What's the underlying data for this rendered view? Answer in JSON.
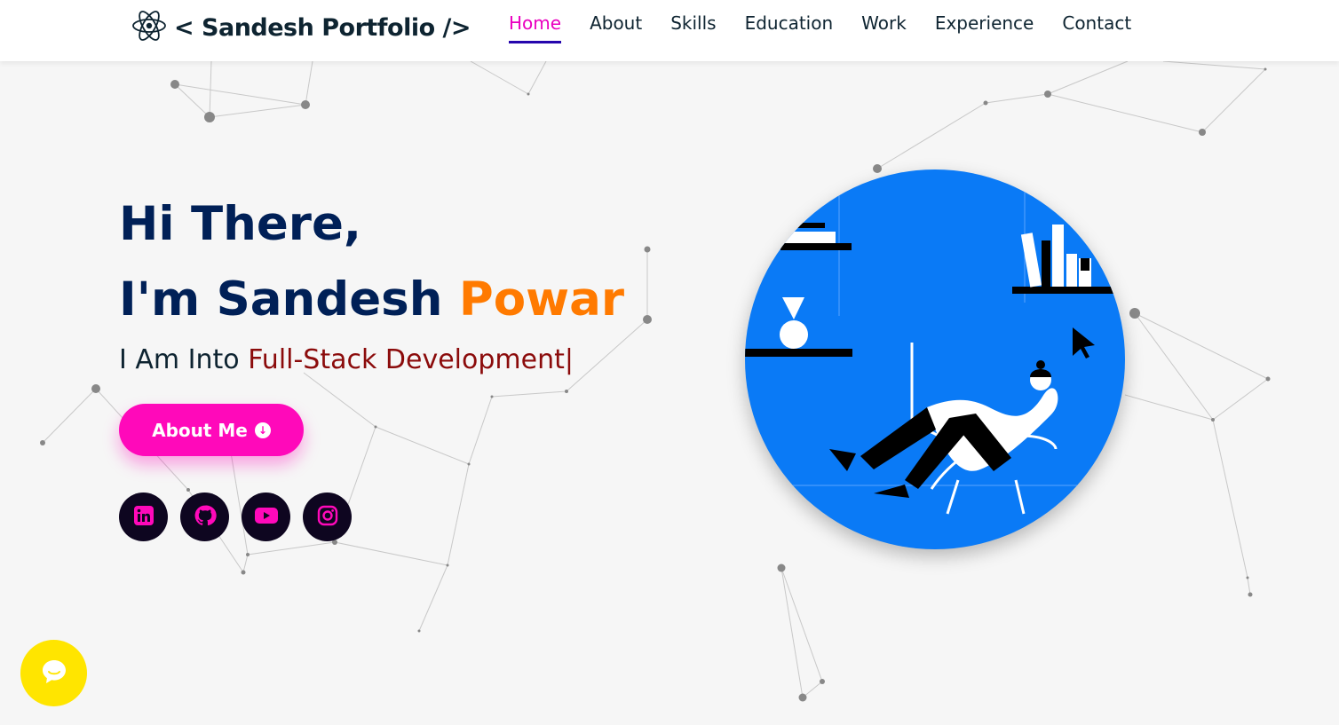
{
  "header": {
    "logo_icon": "react-atom-icon",
    "logo_text": "< Sandesh Portfolio />",
    "nav": [
      {
        "label": "Home",
        "active": true
      },
      {
        "label": "About"
      },
      {
        "label": "Skills"
      },
      {
        "label": "Education"
      },
      {
        "label": "Work"
      },
      {
        "label": "Experience"
      },
      {
        "label": "Contact"
      }
    ]
  },
  "hero": {
    "greeting": "Hi There,",
    "intro": "I'm Sandesh ",
    "name_accent": "Powar",
    "sub_prefix": "I Am Into ",
    "sub_role": "Full-Stack Development",
    "cursor": "|",
    "button_label": "About Me",
    "button_icon": "arrow-down-circle-icon"
  },
  "socials": [
    {
      "name": "linkedin-icon"
    },
    {
      "name": "github-icon"
    },
    {
      "name": "youtube-icon"
    },
    {
      "name": "instagram-icon"
    }
  ],
  "colors": {
    "nav_active": "#ea00c0",
    "nav_underline": "#2506ad",
    "heading": "#002057",
    "accent": "#ff7a00",
    "role": "#8b0b0b",
    "button": "#ff09ba",
    "social_bg": "#0e0620",
    "illustration_bg": "#0a7af6",
    "chat_bubble": "#ffe500"
  },
  "chat_widget": {
    "icon": "chat-bubble-icon"
  }
}
